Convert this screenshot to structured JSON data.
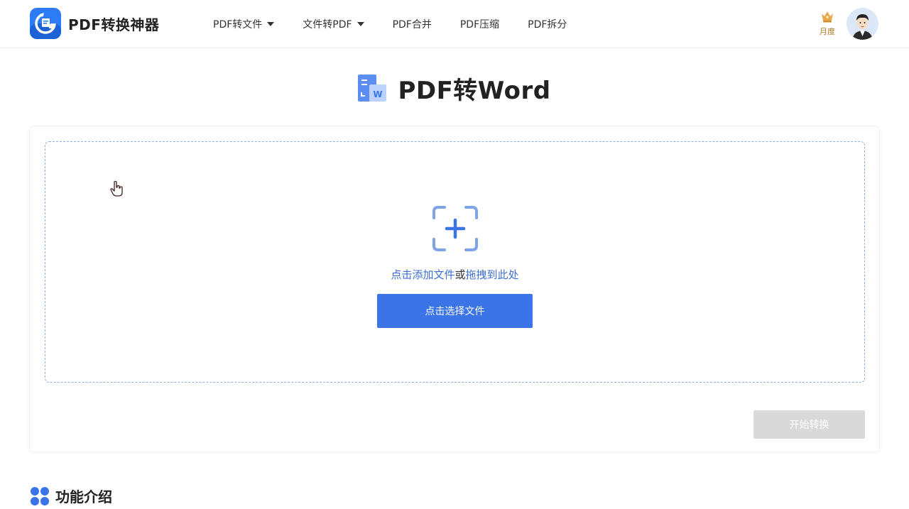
{
  "header": {
    "brand": "PDF转换神器",
    "logo_icon": "app-logo-icon",
    "nav": [
      {
        "label": "PDF转文件",
        "has_dropdown": true
      },
      {
        "label": "文件转PDF",
        "has_dropdown": true
      },
      {
        "label": "PDF合并",
        "has_dropdown": false
      },
      {
        "label": "PDF压缩",
        "has_dropdown": false
      },
      {
        "label": "PDF拆分",
        "has_dropdown": false
      }
    ],
    "vip_label": "月度",
    "vip_icon": "crown-icon",
    "avatar_icon": "user-avatar"
  },
  "main": {
    "title": "PDF转Word",
    "title_icon": "pdf-to-word-icon",
    "upload": {
      "add_icon": "add-file-icon",
      "hint_action": "点击添加文件",
      "hint_or": "或",
      "hint_drag": "拖拽到此处",
      "select_button": "点击选择文件"
    },
    "start_button": "开始转换"
  },
  "section": {
    "title": "功能介绍",
    "icon": "four-dots-icon"
  },
  "colors": {
    "primary": "#3b74e6",
    "link": "#3d6fd0",
    "disabled": "#d9d9d9",
    "dropzone_border": "#8fb0de",
    "vip_gold": "#b07a2a"
  }
}
